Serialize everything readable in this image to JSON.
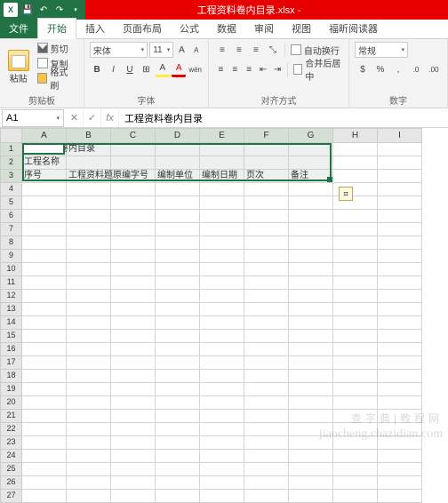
{
  "titlebar": {
    "filename": "工程资料卷内目录.xlsx -"
  },
  "tabs": {
    "file": "文件",
    "home": "开始",
    "insert": "插入",
    "layout": "页面布局",
    "formulas": "公式",
    "data": "数据",
    "review": "审阅",
    "view": "视图",
    "foxit": "福昕阅读器"
  },
  "ribbon": {
    "clipboard": {
      "paste": "粘贴",
      "cut": "剪切",
      "copy": "复制",
      "format_painter": "格式刷",
      "label": "剪贴板"
    },
    "font": {
      "name": "宋体",
      "size": "11",
      "label": "字体"
    },
    "alignment": {
      "wrap": "自动换行",
      "merge": "合并后居中",
      "label": "对齐方式"
    },
    "number": {
      "format": "常规",
      "label": "数字"
    }
  },
  "fxbar": {
    "namebox": "A1",
    "formula": "工程资料卷内目录"
  },
  "columns": [
    "A",
    "B",
    "C",
    "D",
    "E",
    "F",
    "G",
    "H",
    "I"
  ],
  "rows_count": 27,
  "selected_cols": 7,
  "selected_rows": 3,
  "cells": {
    "r1": {
      "A": "工程资料卷内目录"
    },
    "r2": {
      "A": "工程名称"
    },
    "r3": {
      "A": "序号",
      "B": "工程资料题",
      "C": "原编字号",
      "D": "编制单位",
      "E": "编制日期",
      "F": "页次",
      "G": "备注"
    }
  },
  "watermark": {
    "line1": "查字典|教程网",
    "line2": "jiaocheng.chazidian.com"
  }
}
